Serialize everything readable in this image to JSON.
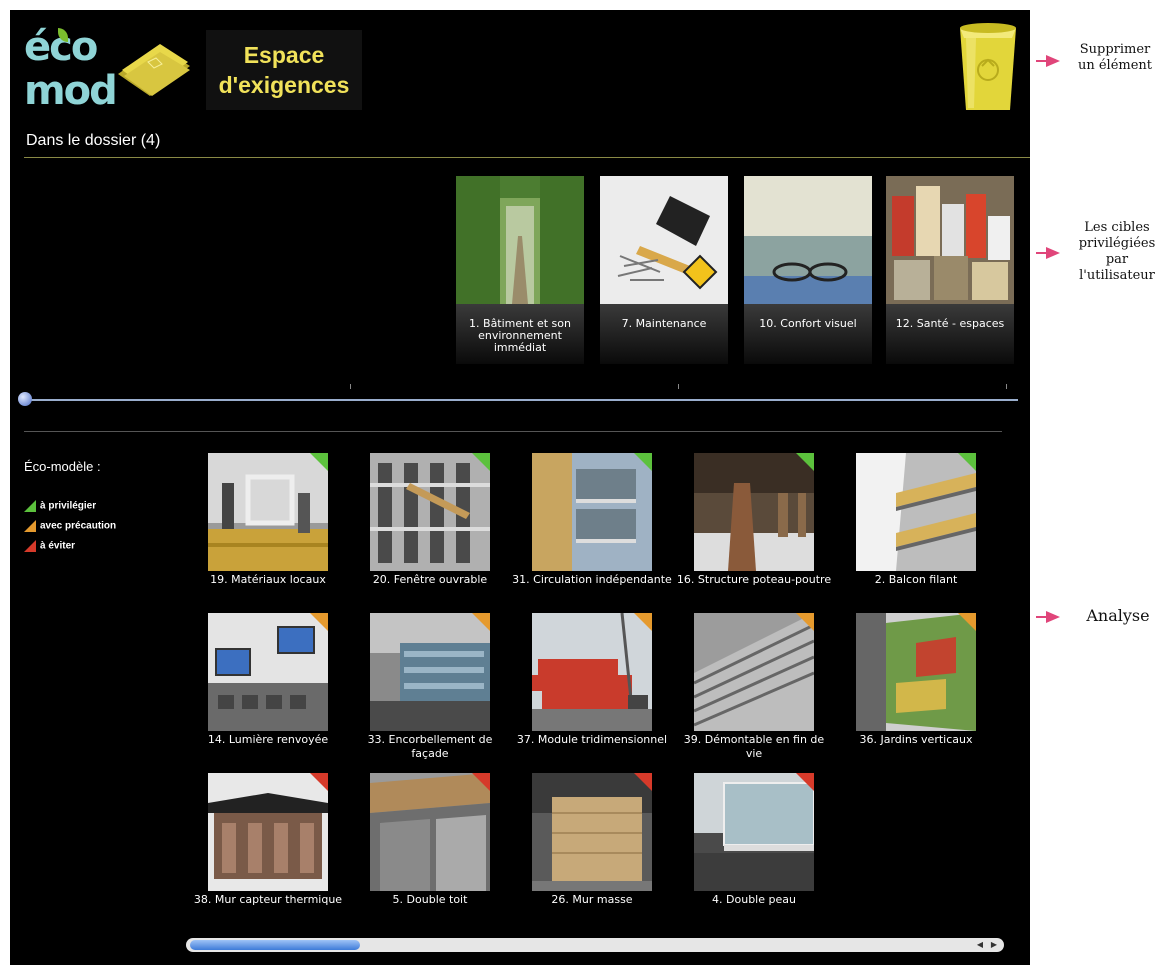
{
  "header": {
    "logo_line1": "éco",
    "logo_line2": "mod",
    "title": "Espace d'exigences"
  },
  "dossier": {
    "title": "Dans le dossier (4)",
    "targets": [
      {
        "label": "1. Bâtiment et son environnement immédiat"
      },
      {
        "label": "7. Maintenance"
      },
      {
        "label": "10. Confort visuel"
      },
      {
        "label": "12. Santé - espaces"
      }
    ],
    "slider_value": 0
  },
  "legend": {
    "title": "Éco-modèle :",
    "items": [
      {
        "label": "à privilégier",
        "color": "#5cc13d"
      },
      {
        "label": "avec précaution",
        "color": "#e59a2e"
      },
      {
        "label": "à éviter",
        "color": "#d63a2a"
      }
    ]
  },
  "models": [
    {
      "label": "19. Matériaux locaux",
      "status": "à privilégier"
    },
    {
      "label": "20. Fenêtre ouvrable",
      "status": "à privilégier"
    },
    {
      "label": "31. Circulation indépendante",
      "status": "à privilégier"
    },
    {
      "label": "16. Structure poteau-poutre",
      "status": "à privilégier"
    },
    {
      "label": "2. Balcon filant",
      "status": "à privilégier"
    },
    {
      "label": "14. Lumière renvoyée",
      "status": "avec précaution"
    },
    {
      "label": "33. Encorbellement de façade",
      "status": "avec précaution"
    },
    {
      "label": "37. Module tridimensionnel",
      "status": "avec précaution"
    },
    {
      "label": "39. Démontable en fin de vie",
      "status": "avec précaution"
    },
    {
      "label": "36. Jardins verticaux",
      "status": "avec précaution"
    },
    {
      "label": "38. Mur capteur thermique",
      "status": "à éviter"
    },
    {
      "label": "5. Double toit",
      "status": "à éviter"
    },
    {
      "label": "26. Mur masse",
      "status": "à éviter"
    },
    {
      "label": "4. Double peau",
      "status": "à éviter"
    }
  ],
  "annotations": {
    "trash": "Supprimer un élément",
    "targets": "Les cibles privilégiées par l'utilisateur",
    "analysis": "Analyse"
  },
  "colors": {
    "background": "#000000",
    "title_yellow": "#f1e25a",
    "annotation_arrow": "#e0457a"
  }
}
